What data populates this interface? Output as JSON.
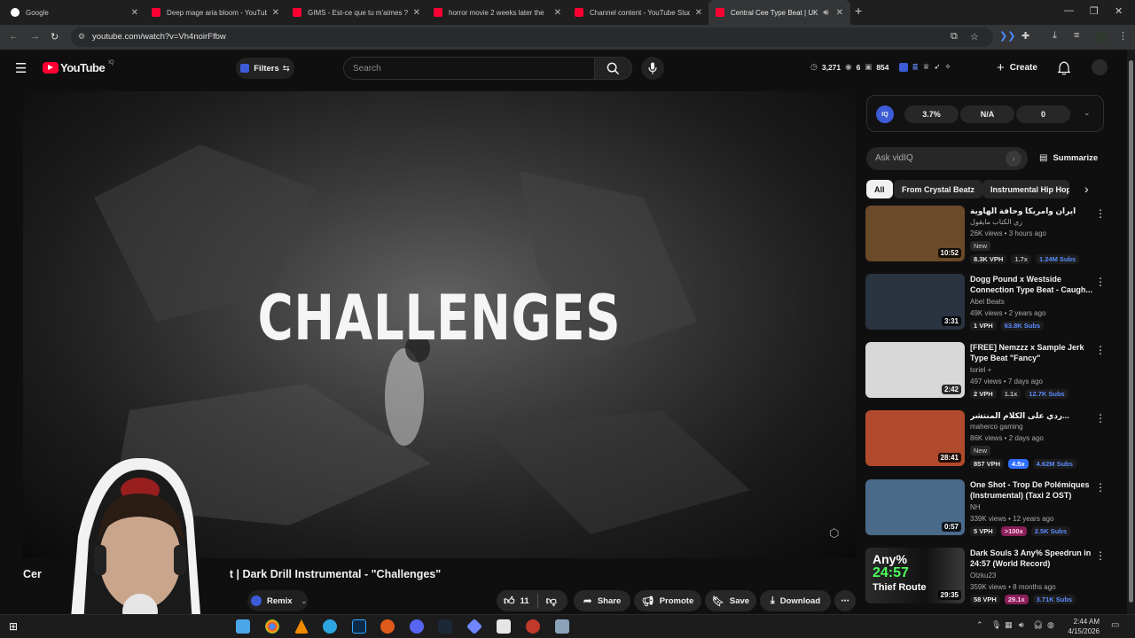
{
  "browser": {
    "tabs": [
      {
        "title": "Google",
        "color": "#ffffff"
      },
      {
        "title": "Deep mage aria bloom - YouTube",
        "color": "#ff0033"
      },
      {
        "title": "GIMS - Est-ce que tu m'aimes ?",
        "color": "#ff0033"
      },
      {
        "title": "horror movie 2 weeks later the",
        "color": "#ff0033"
      },
      {
        "title": "Channel content - YouTube Studio",
        "color": "#ff0033"
      },
      {
        "title": "Central Cee Type Beat | UK",
        "color": "#ff0033"
      }
    ],
    "url": "youtube.com/watch?v=Vh4noirFfbw"
  },
  "yt_header": {
    "logo_text": "YouTube",
    "logo_sup": "IQ",
    "filters_label": "Filters",
    "search_placeholder": "Search",
    "stats": {
      "views": "3,271",
      "a": "6",
      "b": "854"
    },
    "create_label": "Create"
  },
  "player": {
    "overlay_text": "CHALLENGES"
  },
  "video": {
    "title_start": "Cer",
    "title_end": "t | Dark Drill Instrumental - \"Challenges\"",
    "remix_label": "Remix",
    "like_count": "11",
    "share_label": "Share",
    "promote_label": "Promote",
    "save_label": "Save",
    "download_label": "Download"
  },
  "vidiq": {
    "stats": [
      "3.7%",
      "N/A",
      "0"
    ],
    "ask_placeholder": "Ask vidIQ",
    "summarize_label": "Summarize"
  },
  "chips": [
    "All",
    "From Crystal Beatz",
    "Instrumental Hip Hop"
  ],
  "recommendations": [
    {
      "title": "ايران وامريكا وحافة الهاوية",
      "channel": "زي الكتاب مايقول",
      "meta": "26K views • 3 hours ago",
      "badge": "New",
      "duration": "10:52",
      "vph": "8.3K VPH",
      "mult": "1.7x",
      "subs": "1.24M Subs",
      "thumb": "#6b4a2a"
    },
    {
      "title": "Dogg Pound x Westside Connection Type Beat - Caugh...",
      "channel": "Abel Beats",
      "meta": "49K views • 2 years ago",
      "badge": "",
      "duration": "3:31",
      "vph": "1 VPH",
      "mult": "",
      "subs": "63.8K Subs",
      "thumb": "#2a3340"
    },
    {
      "title": "[FREE] Nemzzz x Sample Jerk Type Beat \"Fancy\"",
      "channel": "toriel +",
      "meta": "497 views • 7 days ago",
      "badge": "",
      "duration": "2:42",
      "vph": "2 VPH",
      "mult": "1.1x",
      "subs": "12.7K Subs",
      "thumb": "#d8d8d8"
    },
    {
      "title": "ردي على الكلام المنتشر...",
      "channel": "maherco gaming",
      "meta": "86K views • 2 days ago",
      "badge": "New",
      "duration": "28:41",
      "vph": "857 VPH",
      "mult": "4.5x",
      "subs": "4.62M Subs",
      "thumb": "#b14a2c"
    },
    {
      "title": "One Shot - Trop De Polémiques (Instrumental) (Taxi 2 OST)",
      "channel": "NH",
      "meta": "339K views • 12 years ago",
      "badge": "",
      "duration": "0:57",
      "vph": "5 VPH",
      "mult": ">100x",
      "subs": "2.5K Subs",
      "thumb": "#4a6a8a"
    },
    {
      "title": "Dark Souls 3 Any% Speedrun in 24:57 (World Record)",
      "channel": "Olzku23",
      "meta": "359K views • 8 months ago",
      "badge": "",
      "duration": "29:35",
      "vph": "58 VPH",
      "mult": "29.1x",
      "subs": "3.71K Subs",
      "thumb": "#1e1e1e"
    }
  ],
  "rec3_thumb_text": [
    "Any%",
    "24:57",
    "Thief Route"
  ],
  "taskbar": {
    "time": "2:44 AM",
    "date": "4/15/2026"
  }
}
